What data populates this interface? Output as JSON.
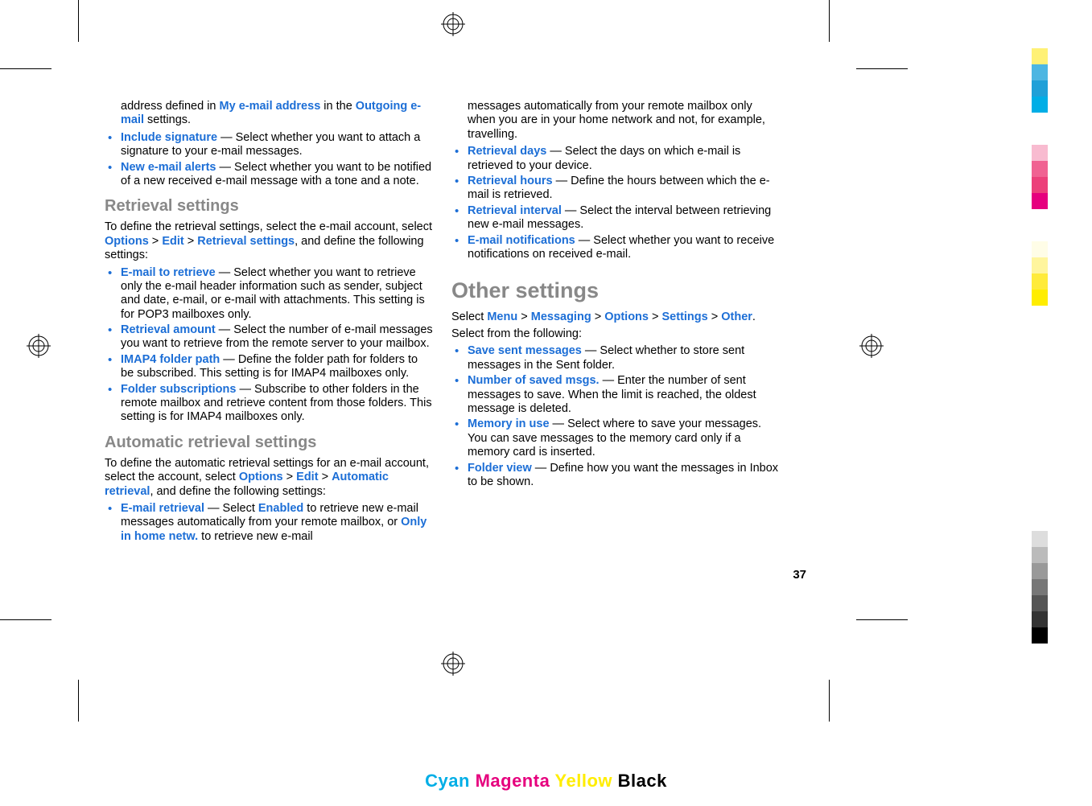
{
  "col1": {
    "intro_line": "address defined in ",
    "intro_bold1": "My e-mail address",
    "intro_mid": " in the ",
    "intro_bold2": "Outgoing e-mail",
    "intro_end": " settings.",
    "items_a": [
      {
        "label": "Include signature",
        "desc": " — Select whether you want to attach a signature to your e-mail messages."
      },
      {
        "label": "New e-mail alerts",
        "desc": " — Select whether you want to be notified of a new received e-mail message with a tone and a note."
      }
    ],
    "h1": "Retrieval settings",
    "p1_a": "To define the retrieval settings, select the e-mail account, select ",
    "opt": "Options",
    "gt": " > ",
    "edit": "Edit",
    "retr": "Retrieval settings",
    "p1_b": ", and define the following settings:",
    "items_b": [
      {
        "label": "E-mail to retrieve",
        "desc": " — Select whether you want to retrieve only the e-mail header information such as sender, subject and date, e-mail, or e-mail with attachments. This setting is for POP3 mailboxes only."
      },
      {
        "label": "Retrieval amount",
        "desc": " — Select the number of e-mail messages you want to retrieve from the remote server to your mailbox."
      },
      {
        "label": "IMAP4 folder path",
        "desc": " — Define the folder path for folders to be subscribed. This setting is for IMAP4 mailboxes only."
      },
      {
        "label": "Folder subscriptions",
        "desc": " — Subscribe to other folders in the remote mailbox and retrieve content from those folders. This setting is for IMAP4 mailboxes only."
      }
    ],
    "h2": "Automatic retrieval settings",
    "p2_a": "To define the automatic retrieval settings for an e-mail account, select the account, select ",
    "autoretr": "Automatic retrieval",
    "p2_b": ", and define the following settings:",
    "items_c_label": "E-mail retrieval",
    "items_c_pre": " — Select ",
    "items_c_enabled": "Enabled",
    "items_c_mid": " to retrieve new e-mail messages automatically from your remote mailbox, or ",
    "items_c_only": "Only in home netw.",
    "items_c_end": " to retrieve new e-mail"
  },
  "col2": {
    "cont": "messages automatically from your remote mailbox only when you are in your home network and not, for example, travelling.",
    "items_d": [
      {
        "label": "Retrieval days",
        "desc": " — Select the days on which e-mail is retrieved to your device."
      },
      {
        "label": "Retrieval hours",
        "desc": " — Define the hours between which the e-mail is retrieved."
      },
      {
        "label": "Retrieval interval",
        "desc": " — Select the interval between retrieving new e-mail messages."
      },
      {
        "label": "E-mail notifications",
        "desc": " — Select whether you want to receive notifications on received e-mail."
      }
    ],
    "h3": "Other settings",
    "p3_a": "Select ",
    "menu": "Menu",
    "messaging": "Messaging",
    "options": "Options",
    "settings": "Settings",
    "other": "Other",
    "p3_b": ".",
    "p4": "Select from the following:",
    "items_e": [
      {
        "label": "Save sent messages",
        "desc": " — Select whether to store sent messages in the Sent folder."
      },
      {
        "label": "Number of saved msgs.",
        "desc": " — Enter the number of sent messages to save. When the limit is reached, the oldest message is deleted."
      },
      {
        "label": "Memory in use",
        "desc": " — Select where to save your messages. You can save messages to the memory card only if a memory card is inserted."
      },
      {
        "label": "Folder view",
        "desc": " — Define how you want the messages in Inbox to be shown."
      }
    ]
  },
  "pagenum": "37",
  "cmyk": {
    "c": "Cyan",
    "m": "Magenta",
    "y": "Yellow",
    "k": "Black"
  }
}
